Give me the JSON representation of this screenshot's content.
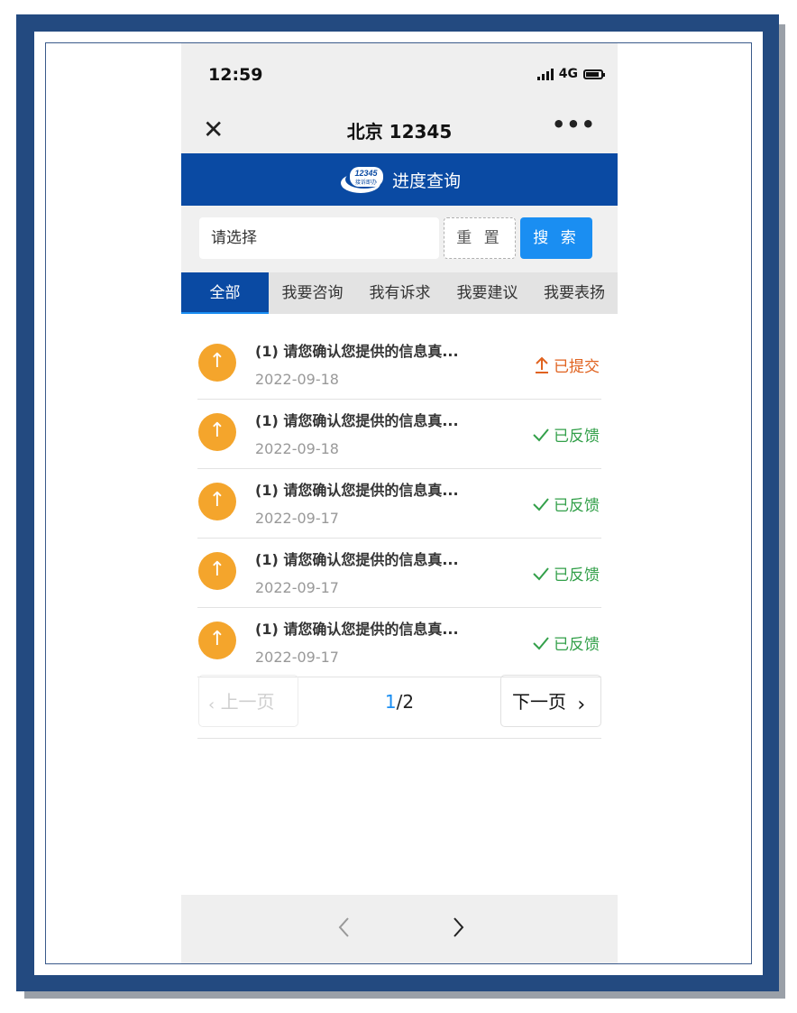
{
  "status_bar": {
    "time": "12:59",
    "network": "4G"
  },
  "nav": {
    "title": "北京 12345",
    "close_icon": "close-icon",
    "more_icon": "more-icon"
  },
  "banner": {
    "logo_text": "12345",
    "logo_subtext": "接诉即办",
    "title": "进度查询"
  },
  "search": {
    "select_value": "请选择",
    "reset_label": "重 置",
    "search_label": "搜 索"
  },
  "tabs": [
    {
      "label": "全部",
      "active": true
    },
    {
      "label": "我要咨询",
      "active": false
    },
    {
      "label": "我有诉求",
      "active": false
    },
    {
      "label": "我要建议",
      "active": false
    },
    {
      "label": "我要表扬",
      "active": false
    }
  ],
  "items": [
    {
      "title": "(1) 请您确认您提供的信息真...",
      "date": "2022-09-18",
      "status": "已提交",
      "status_type": "submitted"
    },
    {
      "title": "(1) 请您确认您提供的信息真...",
      "date": "2022-09-18",
      "status": "已反馈",
      "status_type": "feedback"
    },
    {
      "title": "(1) 请您确认您提供的信息真...",
      "date": "2022-09-17",
      "status": "已反馈",
      "status_type": "feedback"
    },
    {
      "title": "(1) 请您确认您提供的信息真...",
      "date": "2022-09-17",
      "status": "已反馈",
      "status_type": "feedback"
    },
    {
      "title": "(1) 请您确认您提供的信息真...",
      "date": "2022-09-17",
      "status": "已反馈",
      "status_type": "feedback"
    }
  ],
  "pagination": {
    "prev_label": "上一页",
    "next_label": "下一页",
    "current": "1",
    "total": "/2"
  },
  "colors": {
    "brand_blue": "#0a4aa3",
    "accent_blue": "#1a8ef2",
    "submitted": "#e0621f",
    "feedback": "#33a04a",
    "item_icon": "#f4a52c"
  }
}
